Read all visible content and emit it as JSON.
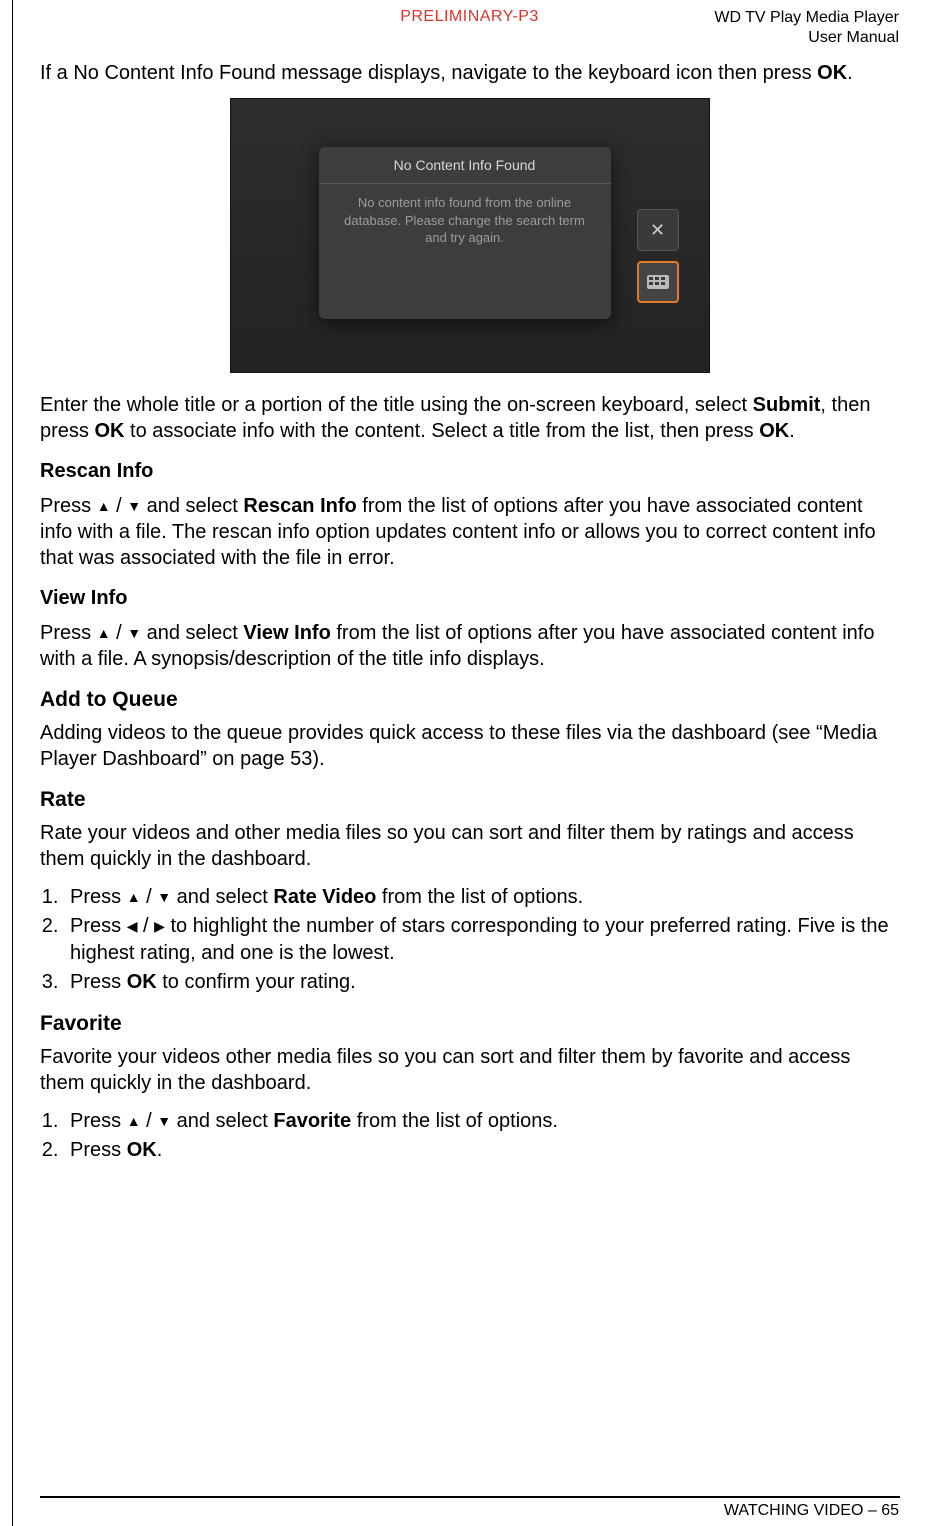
{
  "header": {
    "center": "PRELIMINARY-P3",
    "right_line1": "WD TV Play Media Player",
    "right_line2": "User Manual"
  },
  "intro": {
    "p1_a": "If a No Content Info Found message displays, navigate to the keyboard icon then press ",
    "p1_b": "OK",
    "p1_c": "."
  },
  "figure": {
    "dialog_title": "No Content Info Found",
    "dialog_body": "No content info found from the online database. Please change the search term and try again.",
    "close_glyph": "✕"
  },
  "after_fig": {
    "a": "Enter the whole title or a portion of the title using the on-screen keyboard, select ",
    "b": "Submit",
    "c": ", then press ",
    "d": "OK",
    "e": " to associate info with the content. Select a title from the list, then press ",
    "f": "OK",
    "g": "."
  },
  "rescan": {
    "heading": "Rescan Info",
    "a": "Press ",
    "b": " and select ",
    "c": "Rescan Info",
    "d": " from the list of options after you have associated content info with a file. The rescan info option updates content info or allows you to correct content info that was associated with the file in error."
  },
  "viewinfo": {
    "heading": "View Info",
    "a": "Press ",
    "b": " and select ",
    "c": "View Info",
    "d": " from the list of options after you have associated content info with a file. A synopsis/description of the title info displays."
  },
  "queue": {
    "heading": "Add to Queue",
    "body": "Adding videos to the queue provides quick access to these files via the dashboard (see “Media Player Dashboard” on page 53)."
  },
  "rate": {
    "heading": "Rate",
    "intro": "Rate your videos and other media files so you can sort and filter them by ratings and access them quickly in the dashboard.",
    "s1a": "Press ",
    "s1b": " and select ",
    "s1c": "Rate Video",
    "s1d": " from the list of options.",
    "s2a": "Press ",
    "s2b": " to highlight the number of stars corresponding to your preferred rating. Five is the highest rating, and one is the lowest.",
    "s3a": "Press ",
    "s3b": "OK",
    "s3c": " to confirm your rating."
  },
  "favorite": {
    "heading": "Favorite",
    "intro": "Favorite your videos other media files so you can sort and filter them by favorite and access them quickly in the dashboard.",
    "s1a": "Press ",
    "s1b": " and select ",
    "s1c": "Favorite",
    "s1d": " from the list of options.",
    "s2a": "Press ",
    "s2b": "OK",
    "s2c": "."
  },
  "footer": {
    "section": "WATCHING VIDEO – ",
    "page": "65"
  },
  "glyphs": {
    "up": "▲",
    "down": "▼",
    "left": "◀",
    "right": "▶",
    "slash": " / "
  }
}
